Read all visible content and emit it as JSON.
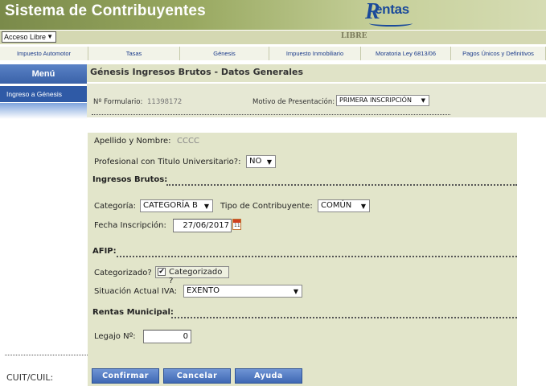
{
  "header": {
    "title": "Sistema de Contribuyentes",
    "logo_text": "entas",
    "logo_initial": "R"
  },
  "access": {
    "selected": "Acceso Libre",
    "mode_label": "LIBRE"
  },
  "nav": {
    "items": [
      "Impuesto Automotor",
      "Tasas",
      "Génesis",
      "Impuesto Inmobiliario",
      "Moratoria Ley 6813/06",
      "Pagos Únicos y Definitivos"
    ]
  },
  "sidebar": {
    "title": "Menú",
    "items": [
      "Ingreso a Génesis"
    ]
  },
  "page": {
    "title": "Génesis Ingresos Brutos - Datos Generales"
  },
  "form_header": {
    "formulario_label": "Nº Formulario:",
    "formulario_value": "11398172",
    "motivo_label": "Motivo de Presentación:",
    "motivo_value": "PRIMERA INSCRIPCIÓN"
  },
  "form": {
    "apellido_label": "Apellido y Nombre:",
    "apellido_value": "CCCC",
    "profesional_label": "Profesional con Titulo Universitario?:",
    "profesional_value": "NO",
    "ingresos_section": "Ingresos Brutos:",
    "categoria_label": "Categoría:",
    "categoria_value": "CATEGORÍA B",
    "tipo_label": "Tipo de Contribuyente:",
    "tipo_value": "COMÚN",
    "fecha_label": "Fecha Inscripción:",
    "fecha_value": "27/06/2017",
    "afip_section": "AFIP:",
    "categorizado_label": "Categorizado?",
    "categorizado_checkbox_label": "Categorizado ?",
    "categorizado_checked": true,
    "iva_label": "Situación Actual IVA:",
    "iva_value": "EXENTO",
    "rentas_section": "Rentas Municipal:",
    "legajo_label": "Legajo Nº:",
    "legajo_value": "0"
  },
  "buttons": {
    "confirm": "Confirmar",
    "cancel": "Cancelar",
    "help": "Ayuda"
  },
  "footer": {
    "cuit_label": "CUIT/CUIL:"
  },
  "colors": {
    "header_green": "#98a860",
    "nav_blue": "#2f5aa6",
    "panel_bg": "#e2e5ca"
  }
}
